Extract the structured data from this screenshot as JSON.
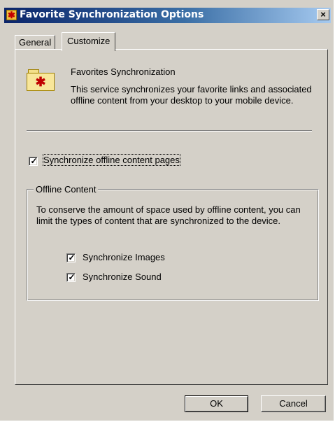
{
  "window": {
    "title": "Favorite Synchronization Options",
    "close_glyph": "×"
  },
  "tabs": [
    {
      "label": "General",
      "selected": false
    },
    {
      "label": "Customize",
      "selected": true
    }
  ],
  "service": {
    "icon": "favorites-folder-icon",
    "heading": "Favorites Synchronization",
    "description": "This service synchronizes your favorite links and associated offline content from your desktop to your mobile device."
  },
  "options": {
    "sync_offline_pages": {
      "label": "Synchronize offline content pages",
      "checked": true
    }
  },
  "offline_content": {
    "group_title": "Offline Content",
    "text": "To conserve the amount of space used by offline content, you can limit the types of content that are synchronized to the device.",
    "sync_images": {
      "label": "Synchronize Images",
      "checked": true
    },
    "sync_sound": {
      "label": "Synchronize Sound",
      "checked": true
    }
  },
  "buttons": {
    "ok": "OK",
    "cancel": "Cancel"
  },
  "colors": {
    "dialog_face": "#d4d0c8",
    "title_gradient_start": "#0a246a",
    "title_gradient_end": "#a6caf0"
  }
}
